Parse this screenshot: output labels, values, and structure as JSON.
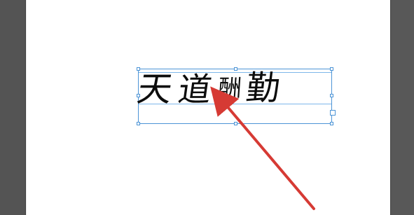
{
  "document": {
    "text_frame": {
      "characters": [
        "天",
        "道",
        "酬",
        "勤"
      ]
    }
  },
  "annotation": {
    "arrow_color": "#d63a34"
  },
  "ui_colors": {
    "workspace_background": "#5a5a5a",
    "artboard_background": "#ffffff",
    "selection_blue": "#4c94d6"
  }
}
